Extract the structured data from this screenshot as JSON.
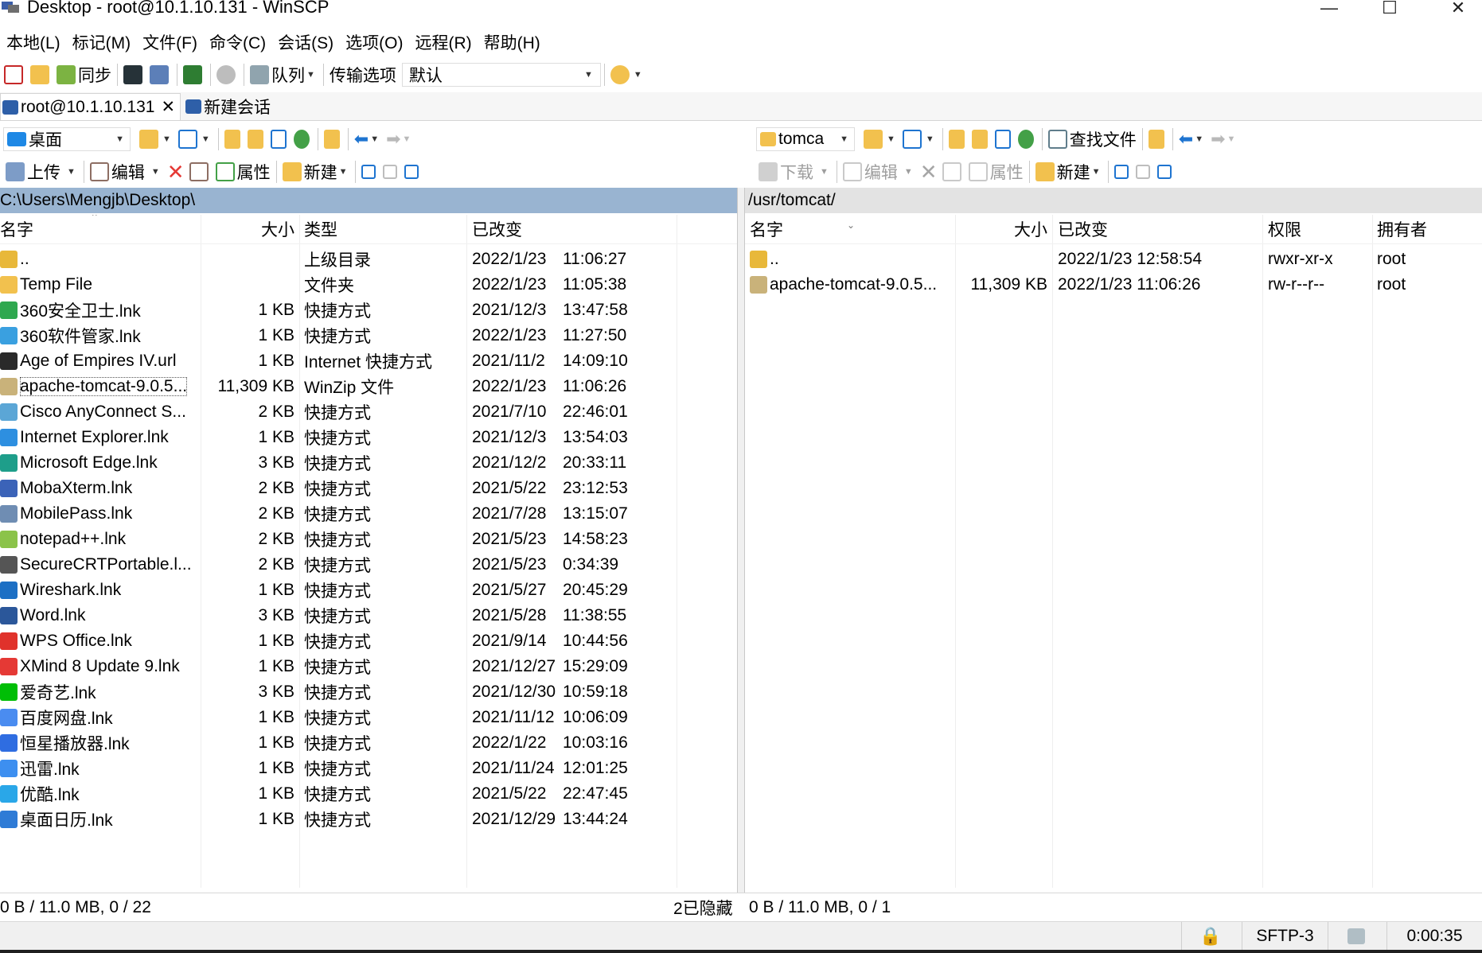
{
  "window": {
    "title": "Desktop - root@10.1.10.131 - WinSCP",
    "minimize_glyph": "—",
    "maximize_glyph": "☐",
    "close_glyph": "✕"
  },
  "menu": [
    "本地(L)",
    "标记(M)",
    "文件(F)",
    "命令(C)",
    "会话(S)",
    "选项(O)",
    "远程(R)",
    "帮助(H)"
  ],
  "toolbar_main": {
    "sync_label": "同步",
    "queue_label": "队列",
    "transfer_options_label": "传输选项",
    "transfer_preset": "默认"
  },
  "tabs": {
    "session": "root@10.1.10.131",
    "close_glyph": "✕",
    "new_session": "新建会话"
  },
  "local": {
    "drive": "桌面",
    "upload_label": "上传",
    "edit_label": "编辑",
    "properties_label": "属性",
    "new_label": "新建",
    "path": "C:\\Users\\Mengjb\\Desktop\\",
    "columns": {
      "name": "名字",
      "size": "大小",
      "type": "类型",
      "changed": "已改变"
    },
    "files": [
      {
        "name": "..",
        "size": "",
        "type": "上级目录",
        "date": "2022/1/23",
        "time": "11:06:27",
        "icon": "folder-up-icon",
        "color": "#e8b83a"
      },
      {
        "name": "Temp File",
        "size": "",
        "type": "文件夹",
        "date": "2022/1/23",
        "time": "11:05:38",
        "icon": "folder-icon",
        "color": "#f2c14e"
      },
      {
        "name": "360安全卫士.lnk",
        "size": "1 KB",
        "type": "快捷方式",
        "date": "2021/12/3",
        "time": "13:47:58",
        "icon": "360-safe-icon",
        "color": "#2fa84f"
      },
      {
        "name": "360软件管家.lnk",
        "size": "1 KB",
        "type": "快捷方式",
        "date": "2022/1/23",
        "time": "11:27:50",
        "icon": "360-software-icon",
        "color": "#3aa0e0"
      },
      {
        "name": "Age of Empires IV.url",
        "size": "1 KB",
        "type": "Internet 快捷方式",
        "date": "2021/11/2",
        "time": "14:09:10",
        "icon": "age-of-empires-icon",
        "color": "#2a2a2a"
      },
      {
        "name": "apache-tomcat-9.0.5...",
        "size": "11,309 KB",
        "type": "WinZip 文件",
        "date": "2022/1/23",
        "time": "11:06:26",
        "icon": "zip-file-icon",
        "color": "#c9b27a"
      },
      {
        "name": "Cisco AnyConnect S...",
        "size": "2 KB",
        "type": "快捷方式",
        "date": "2021/7/10",
        "time": "22:46:01",
        "icon": "cisco-icon",
        "color": "#5ba6d6"
      },
      {
        "name": "Internet Explorer.lnk",
        "size": "1 KB",
        "type": "快捷方式",
        "date": "2021/12/3",
        "time": "13:54:03",
        "icon": "internet-explorer-icon",
        "color": "#2d8fe0"
      },
      {
        "name": "Microsoft Edge.lnk",
        "size": "3 KB",
        "type": "快捷方式",
        "date": "2021/12/2",
        "time": "20:33:11",
        "icon": "edge-icon",
        "color": "#1e9e8a"
      },
      {
        "name": "MobaXterm.lnk",
        "size": "2 KB",
        "type": "快捷方式",
        "date": "2021/5/22",
        "time": "23:12:53",
        "icon": "mobaxterm-icon",
        "color": "#3b63b8"
      },
      {
        "name": "MobilePass.lnk",
        "size": "2 KB",
        "type": "快捷方式",
        "date": "2021/7/28",
        "time": "13:15:07",
        "icon": "mobilepass-icon",
        "color": "#6f8db3"
      },
      {
        "name": "notepad++.lnk",
        "size": "2 KB",
        "type": "快捷方式",
        "date": "2021/5/23",
        "time": "14:58:23",
        "icon": "notepad-plus-plus-icon",
        "color": "#8bc34a"
      },
      {
        "name": "SecureCRTPortable.l...",
        "size": "2 KB",
        "type": "快捷方式",
        "date": "2021/5/23",
        "time": "0:34:39",
        "icon": "securecrt-icon",
        "color": "#555555"
      },
      {
        "name": "Wireshark.lnk",
        "size": "1 KB",
        "type": "快捷方式",
        "date": "2021/5/27",
        "time": "20:45:29",
        "icon": "wireshark-icon",
        "color": "#1c6fc4"
      },
      {
        "name": "Word.lnk",
        "size": "3 KB",
        "type": "快捷方式",
        "date": "2021/5/28",
        "time": "11:38:55",
        "icon": "word-icon",
        "color": "#2b579a"
      },
      {
        "name": "WPS Office.lnk",
        "size": "1 KB",
        "type": "快捷方式",
        "date": "2021/9/14",
        "time": "10:44:56",
        "icon": "wps-icon",
        "color": "#e0322b"
      },
      {
        "name": "XMind 8 Update 9.lnk",
        "size": "1 KB",
        "type": "快捷方式",
        "date": "2021/12/27",
        "time": "15:29:09",
        "icon": "xmind-icon",
        "color": "#e53935"
      },
      {
        "name": "爱奇艺.lnk",
        "size": "3 KB",
        "type": "快捷方式",
        "date": "2021/12/30",
        "time": "10:59:18",
        "icon": "iqiyi-icon",
        "color": "#00be06"
      },
      {
        "name": "百度网盘.lnk",
        "size": "1 KB",
        "type": "快捷方式",
        "date": "2021/11/12",
        "time": "10:06:09",
        "icon": "baidu-netdisk-icon",
        "color": "#4a8cf0"
      },
      {
        "name": "恒星播放器.lnk",
        "size": "1 KB",
        "type": "快捷方式",
        "date": "2022/1/22",
        "time": "10:03:16",
        "icon": "player-icon",
        "color": "#2f6de1"
      },
      {
        "name": "迅雷.lnk",
        "size": "1 KB",
        "type": "快捷方式",
        "date": "2021/11/24",
        "time": "12:01:25",
        "icon": "xunlei-icon",
        "color": "#3d8ff0"
      },
      {
        "name": "优酷.lnk",
        "size": "1 KB",
        "type": "快捷方式",
        "date": "2021/5/22",
        "time": "22:47:45",
        "icon": "youku-icon",
        "color": "#2aa7e8"
      },
      {
        "name": "桌面日历.lnk",
        "size": "1 KB",
        "type": "快捷方式",
        "date": "2021/12/29",
        "time": "13:44:24",
        "icon": "calendar-icon",
        "color": "#2e7bd6"
      }
    ],
    "status": "0 B / 11.0 MB,   0 / 22",
    "hidden": "2已隐藏"
  },
  "remote": {
    "drive": "tomca",
    "find_files_label": "查找文件",
    "download_label": "下载",
    "edit_label": "编辑",
    "properties_label": "属性",
    "new_label": "新建",
    "path": "/usr/tomcat/",
    "columns": {
      "name": "名字",
      "size": "大小",
      "changed": "已改变",
      "rights": "权限",
      "owner": "拥有者"
    },
    "files": [
      {
        "name": "..",
        "size": "",
        "changed": "2022/1/23 12:58:54",
        "rights": "rwxr-xr-x",
        "owner": "root",
        "icon": "folder-up-icon",
        "color": "#e8b83a"
      },
      {
        "name": "apache-tomcat-9.0.5...",
        "size": "11,309 KB",
        "changed": "2022/1/23 11:06:26",
        "rights": "rw-r--r--",
        "owner": "root",
        "icon": "zip-file-icon",
        "color": "#c9b27a"
      }
    ],
    "status": "0 B / 11.0 MB,   0 / 1"
  },
  "statusbar": {
    "protocol": "SFTP-3",
    "elapsed": "0:00:35"
  },
  "colors": {
    "path_active": "#99b4d1",
    "path_inactive": "#e3e3e3",
    "accent_blue": "#1e74d0"
  }
}
